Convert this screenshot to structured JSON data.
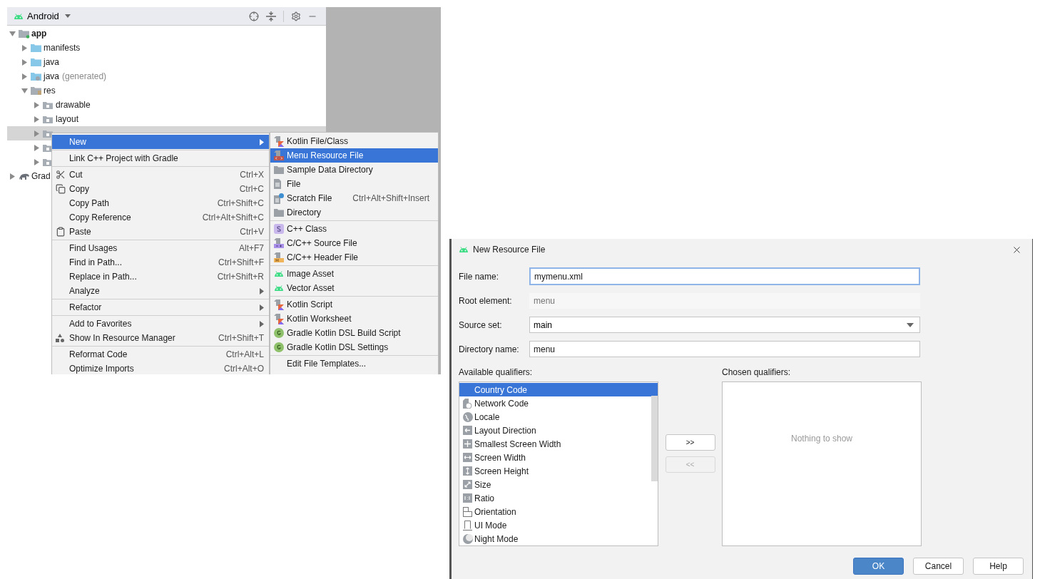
{
  "project_panel": {
    "view_selector": "Android",
    "tree": [
      {
        "label": "app",
        "kind": "module",
        "expanded": true,
        "selected": false,
        "children": [
          {
            "label": "manifests",
            "kind": "folder",
            "expanded": false,
            "selected": false
          },
          {
            "label": "java",
            "kind": "folder",
            "expanded": false,
            "selected": false
          },
          {
            "label": "java",
            "suffix": "(generated)",
            "kind": "generated",
            "expanded": false,
            "selected": false
          },
          {
            "label": "res",
            "kind": "res",
            "expanded": true,
            "selected": false,
            "children": [
              {
                "label": "drawable",
                "kind": "resdir",
                "expanded": false,
                "selected": false
              },
              {
                "label": "layout",
                "kind": "resdir",
                "expanded": false,
                "selected": false
              },
              {
                "kind": "resdir",
                "expanded": false,
                "selected": true
              },
              {
                "kind": "resdir",
                "expanded": false,
                "selected": false
              },
              {
                "kind": "resdir",
                "expanded": false,
                "selected": false
              }
            ]
          }
        ]
      },
      {
        "label": "Grad",
        "kind": "gradle",
        "expanded": false,
        "selected": false
      }
    ]
  },
  "context_menu": {
    "groups": [
      [
        {
          "label": "New",
          "submenu": true,
          "selected": true
        }
      ],
      [
        {
          "label": "Link C++ Project with Gradle",
          "submenu": false,
          "selected": false
        }
      ],
      [
        {
          "label": "Cut",
          "shortcut": "Ctrl+X",
          "kind": "scissors",
          "submenu": false,
          "selected": false
        },
        {
          "label": "Copy",
          "shortcut": "Ctrl+C",
          "kind": "copy",
          "submenu": false,
          "selected": false
        },
        {
          "label": "Copy Path",
          "shortcut": "Ctrl+Shift+C",
          "submenu": false,
          "selected": false
        },
        {
          "label": "Copy Reference",
          "shortcut": "Ctrl+Alt+Shift+C",
          "submenu": false,
          "selected": false
        },
        {
          "label": "Paste",
          "shortcut": "Ctrl+V",
          "kind": "clipboard",
          "submenu": false,
          "selected": false
        }
      ],
      [
        {
          "label": "Find Usages",
          "shortcut": "Alt+F7",
          "submenu": false,
          "selected": false
        },
        {
          "label": "Find in Path...",
          "shortcut": "Ctrl+Shift+F",
          "submenu": false,
          "selected": false
        },
        {
          "label": "Replace in Path...",
          "shortcut": "Ctrl+Shift+R",
          "submenu": false,
          "selected": false
        },
        {
          "label": "Analyze",
          "submenu": true,
          "selected": false
        }
      ],
      [
        {
          "label": "Refactor",
          "submenu": true,
          "selected": false
        }
      ],
      [
        {
          "label": "Add to Favorites",
          "submenu": true,
          "selected": false
        },
        {
          "label": "Show In Resource Manager",
          "shortcut": "Ctrl+Shift+T",
          "kind": "shapes",
          "submenu": false,
          "selected": false
        }
      ],
      [
        {
          "label": "Reformat Code",
          "shortcut": "Ctrl+Alt+L",
          "submenu": false,
          "selected": false
        },
        {
          "label": "Optimize Imports",
          "shortcut": "Ctrl+Alt+O",
          "submenu": false,
          "selected": false
        }
      ]
    ]
  },
  "new_submenu": {
    "groups": [
      [
        {
          "label": "Kotlin File/Class",
          "kind": "kotlin-file",
          "selected": false
        },
        {
          "label": "Menu Resource File",
          "kind": "menu-file",
          "selected": true
        },
        {
          "label": "Sample Data Directory",
          "kind": "folder",
          "selected": false
        },
        {
          "label": "File",
          "kind": "file",
          "selected": false
        },
        {
          "label": "Scratch File",
          "shortcut": "Ctrl+Alt+Shift+Insert",
          "kind": "scratch",
          "selected": false
        },
        {
          "label": "Directory",
          "kind": "folder",
          "selected": false
        }
      ],
      [
        {
          "label": "C++ Class",
          "kind": "cpp-class",
          "selected": false
        },
        {
          "label": "C/C++ Source File",
          "kind": "cpp-source",
          "selected": false
        },
        {
          "label": "C/C++ Header File",
          "kind": "cpp-header",
          "selected": false
        }
      ],
      [
        {
          "label": "Image Asset",
          "kind": "android",
          "selected": false
        },
        {
          "label": "Vector Asset",
          "kind": "android",
          "selected": false
        }
      ],
      [
        {
          "label": "Kotlin Script",
          "kind": "kotlin-script",
          "selected": false
        },
        {
          "label": "Kotlin Worksheet",
          "kind": "kotlin-script",
          "selected": false
        },
        {
          "label": "Gradle Kotlin DSL Build Script",
          "kind": "gradle",
          "selected": false
        },
        {
          "label": "Gradle Kotlin DSL Settings",
          "kind": "gradle",
          "selected": false
        }
      ],
      [
        {
          "label": "Edit File Templates...",
          "selected": false
        }
      ]
    ]
  },
  "dialog": {
    "title": "New Resource File",
    "fields": [
      {
        "label": "File name:",
        "value": "mymenu.xml",
        "kind": "text",
        "focused": true,
        "disabled": false
      },
      {
        "label": "Root element:",
        "value": "menu",
        "kind": "text",
        "focused": false,
        "disabled": true
      },
      {
        "label": "Source set:",
        "value": "main",
        "kind": "dropdown"
      },
      {
        "label": "Directory name:",
        "value": "menu",
        "kind": "text",
        "focused": false,
        "disabled": false
      }
    ],
    "available_qualifiers": {
      "label": "Available qualifiers:",
      "items": [
        {
          "label": "Country Code",
          "kind": "none",
          "selected": true
        },
        {
          "label": "Network Code",
          "kind": "network",
          "selected": false
        },
        {
          "label": "Locale",
          "kind": "globe",
          "selected": false
        },
        {
          "label": "Layout Direction",
          "kind": "direction",
          "selected": false
        },
        {
          "label": "Smallest Screen Width",
          "kind": "move",
          "selected": false
        },
        {
          "label": "Screen Width",
          "kind": "width",
          "selected": false
        },
        {
          "label": "Screen Height",
          "kind": "height",
          "selected": false
        },
        {
          "label": "Size",
          "kind": "size",
          "selected": false
        },
        {
          "label": "Ratio",
          "kind": "ratio",
          "selected": false
        },
        {
          "label": "Orientation",
          "kind": "orientation",
          "selected": false
        },
        {
          "label": "UI Mode",
          "kind": "uimode",
          "selected": false
        },
        {
          "label": "Night Mode",
          "kind": "night",
          "selected": false
        }
      ]
    },
    "move_buttons": [
      {
        "label": ">>",
        "disabled": false
      },
      {
        "label": "<<",
        "disabled": true
      }
    ],
    "chosen_qualifiers": {
      "label": "Chosen qualifiers:",
      "empty_text": "Nothing to show"
    },
    "buttons": [
      {
        "label": "OK",
        "primary": true
      },
      {
        "label": "Cancel",
        "primary": false
      },
      {
        "label": "Help",
        "primary": false
      }
    ]
  }
}
